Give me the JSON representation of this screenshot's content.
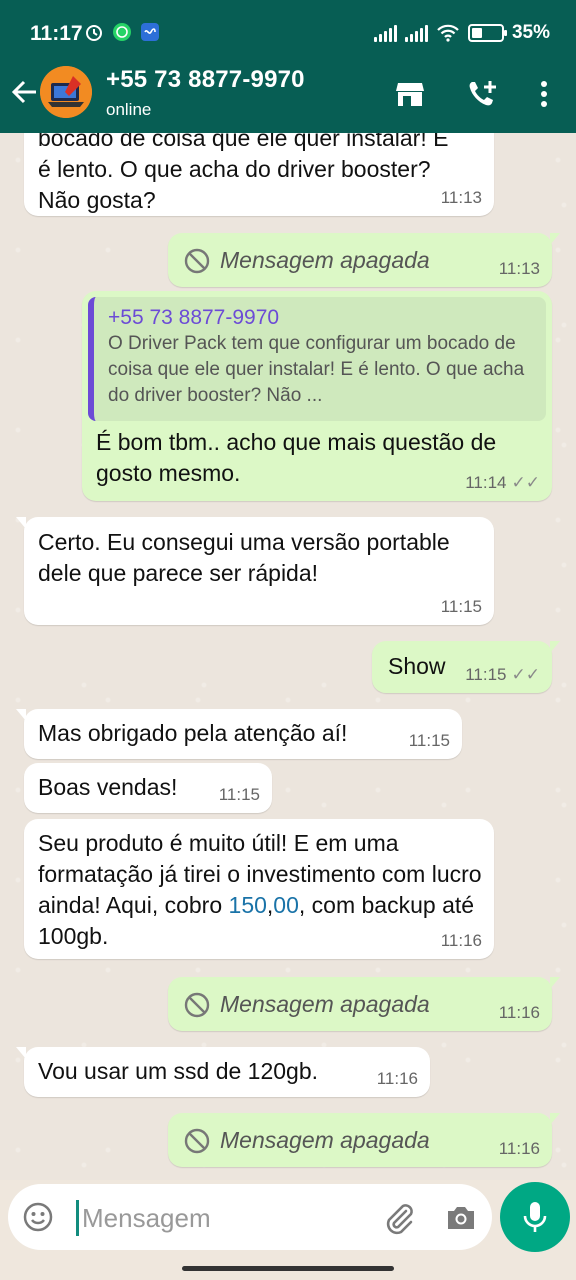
{
  "status_bar": {
    "time": "11:17",
    "battery": "35%",
    "battery_level": 0.35
  },
  "header": {
    "contact_name": "+55 73 8877-9970",
    "status": "online",
    "icons": [
      "back-arrow-icon",
      "store-icon",
      "add-call-icon",
      "more-vert-icon"
    ]
  },
  "messages": [
    {
      "dir": "in",
      "text": "bocado de coisa que ele quer instalar! E é lento. O que acha do driver booster? Não gosta?",
      "time": "11:13"
    },
    {
      "dir": "out",
      "deleted": true,
      "text": "Mensagem apagada",
      "time": "11:13"
    },
    {
      "dir": "out",
      "quote_author": "+55 73 8877-9970",
      "quote_text": "O Driver Pack tem que configurar um bocado de coisa que ele quer instalar! E é lento. O que acha do driver booster? Não ...",
      "text": "É bom tbm.. acho que mais questão de gosto mesmo.",
      "time": "11:14",
      "ticks": "✓✓"
    },
    {
      "dir": "in",
      "text": "Certo. Eu consegui uma versão portable dele que parece ser rápida!",
      "time": "11:15"
    },
    {
      "dir": "out",
      "text": "Show",
      "time": "11:15",
      "ticks": "✓✓"
    },
    {
      "dir": "in",
      "text": "Mas obrigado pela atenção aí!",
      "time": "11:15"
    },
    {
      "dir": "in",
      "text": "Boas vendas!",
      "time": "11:15"
    },
    {
      "dir": "in",
      "text_before": "Seu produto é muito útil! E em uma formatação já tirei o investimento com lucro ainda! Aqui, cobro ",
      "link1": "150",
      "comma": ",",
      "link2": "00",
      "text_after": ", com backup até 100gb.",
      "time": "11:16"
    },
    {
      "dir": "out",
      "deleted": true,
      "text": "Mensagem apagada",
      "time": "11:16"
    },
    {
      "dir": "in",
      "text": "Vou usar um ssd de 120gb.",
      "time": "11:16"
    },
    {
      "dir": "out",
      "deleted": true,
      "text": "Mensagem apagada",
      "time": "11:16"
    }
  ],
  "composer": {
    "placeholder": "Mensagem"
  },
  "colors": {
    "header": "#075e54",
    "outgoing": "#dcf8c6",
    "incoming": "#ffffff",
    "accent": "#00a884",
    "quote_author": "#6c4bd6"
  }
}
